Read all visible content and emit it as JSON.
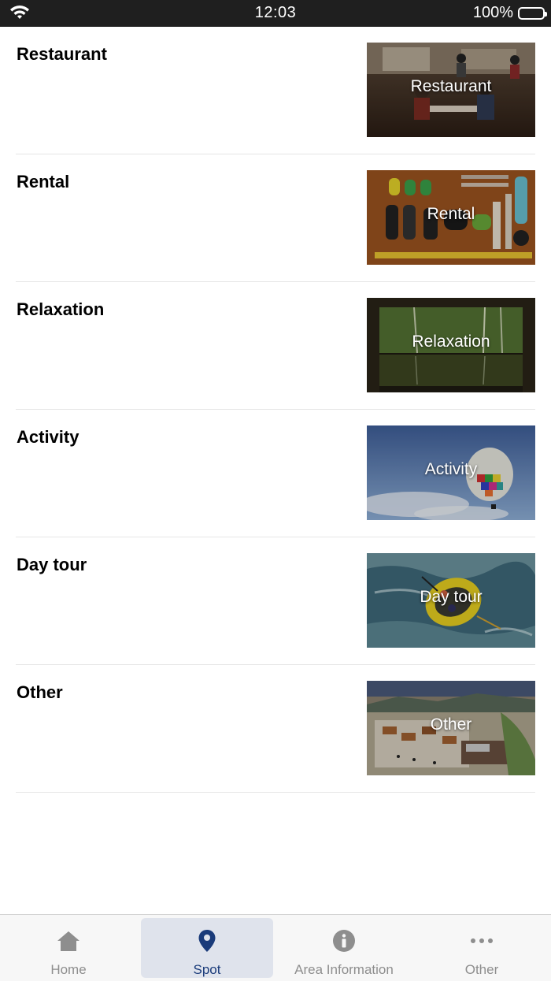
{
  "status_bar": {
    "time": "12:03",
    "battery_percent": "100%"
  },
  "categories": [
    {
      "title": "Restaurant",
      "image_label": "Restaurant"
    },
    {
      "title": "Rental",
      "image_label": "Rental"
    },
    {
      "title": "Relaxation",
      "image_label": "Relaxation"
    },
    {
      "title": "Activity",
      "image_label": "Activity"
    },
    {
      "title": "Day tour",
      "image_label": "Day tour"
    },
    {
      "title": "Other",
      "image_label": "Other"
    }
  ],
  "tab_bar": {
    "active_tab": "Spot",
    "active_color": "#1a3b7a",
    "active_bg": "#dfe3ec",
    "items": [
      {
        "label": "Home",
        "icon": "home-icon"
      },
      {
        "label": "Spot",
        "icon": "map-pin-icon"
      },
      {
        "label": "Area Information",
        "icon": "info-icon"
      },
      {
        "label": "Other",
        "icon": "more-dots-icon"
      }
    ]
  }
}
